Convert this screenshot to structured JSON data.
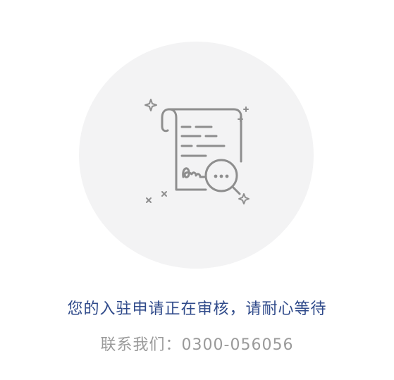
{
  "review": {
    "illustration_icon": "document-under-review-icon",
    "status_message": "您的入驻申请正在审核，请耐心等待",
    "contact_label": "联系我们：",
    "contact_phone": "0300-056056"
  },
  "colors": {
    "status_text": "#2f4a8a",
    "contact_text": "#9a9a9a",
    "circle_bg": "#f3f3f4",
    "icon_stroke": "#8e8e8e"
  }
}
